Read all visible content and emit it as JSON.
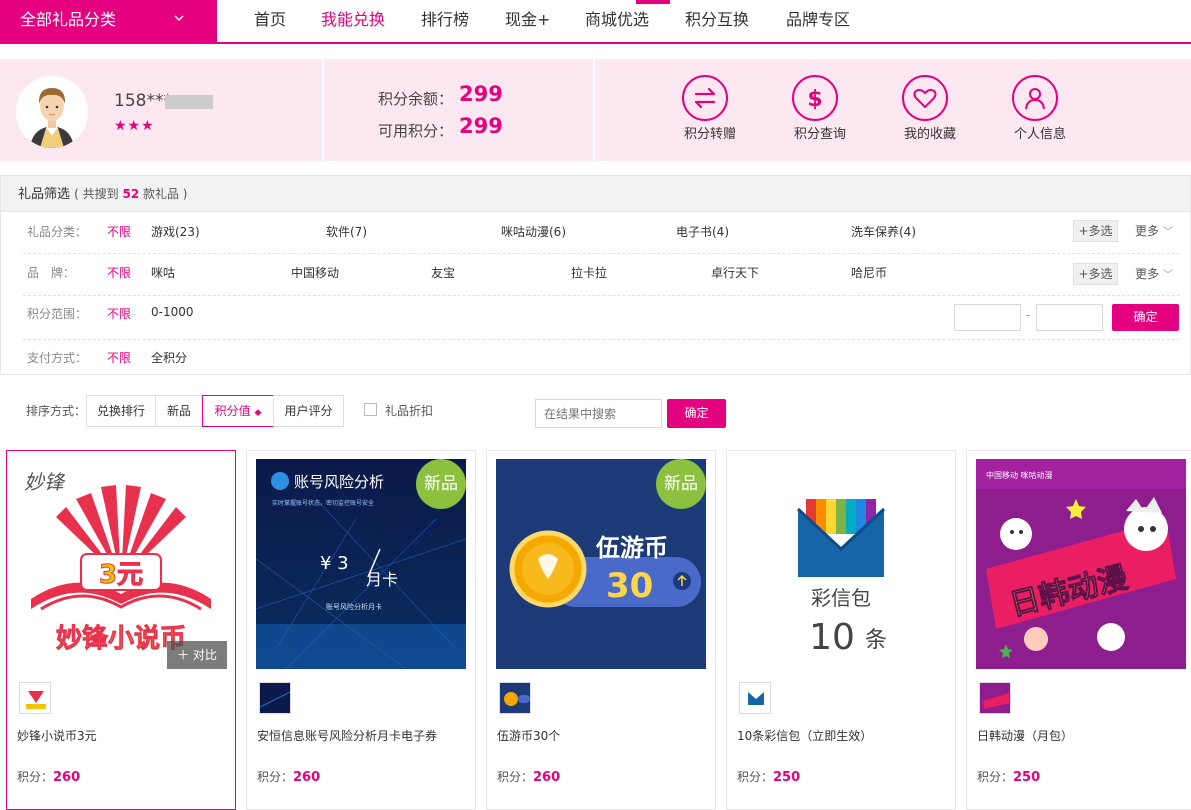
{
  "nav": {
    "category_button": "全部礼品分类",
    "items": [
      "首页",
      "我能兑换",
      "排行榜",
      "现金+",
      "商城优选",
      "积分互换",
      "品牌专区"
    ],
    "active_index": 1
  },
  "user": {
    "phone": "158***",
    "stars": "★★★",
    "balance_label": "积分余额：",
    "balance": "299",
    "available_label": "可用积分：",
    "available": "299",
    "actions": [
      "积分转赠",
      "积分查询",
      "我的收藏",
      "个人信息"
    ],
    "action_icons": [
      "transfer-icon",
      "dollar-icon",
      "heart-icon",
      "person-icon"
    ]
  },
  "filter": {
    "title": "礼品筛选",
    "count_prefix": "( 共搜到 ",
    "count": "52",
    "count_suffix": " 款礼品 )",
    "unlimited": "不限",
    "multi": "+多选",
    "more": "更多",
    "rows": [
      {
        "label": "礼品分类：",
        "options": [
          "游戏(23)",
          "软件(7)",
          "咪咕动漫(6)",
          "电子书(4)",
          "洗车保养(4)"
        ]
      },
      {
        "label": "品　牌：",
        "options": [
          "咪咕",
          "中国移动",
          "友宝",
          "拉卡拉",
          "卓行天下",
          "哈尼币"
        ]
      },
      {
        "label": "积分范围：",
        "options": [
          "0-1000"
        ]
      },
      {
        "label": "支付方式：",
        "options": [
          "全积分"
        ]
      }
    ],
    "range_sep": "-",
    "confirm": "确定"
  },
  "sort": {
    "label": "排序方式：",
    "buttons": [
      "兑换排行",
      "新品",
      "积分值",
      "用户评分"
    ],
    "active_index": 2,
    "discount_label": "礼品折扣",
    "search_placeholder": "在结果中搜索",
    "confirm": "确定"
  },
  "products": [
    {
      "name": "妙锋小说币3元",
      "price_label": "积分：",
      "price": "260",
      "new": false,
      "compare": "对比",
      "img_text": "妙锋",
      "img_amount": "3元",
      "img_caption": "妙锋小说币"
    },
    {
      "name": "安恒信息账号风险分析月卡电子券",
      "price_label": "积分：",
      "price": "260",
      "new": true,
      "badge": "新品",
      "img_title": "账号风险分析",
      "img_sub": "实时掌握账号状态，密切监控账号安全",
      "img_price": "¥ 3",
      "img_card": "月卡",
      "img_caption": "账号风险分析月卡"
    },
    {
      "name": "伍游币30个",
      "price_label": "积分：",
      "price": "260",
      "new": true,
      "badge": "新品",
      "img_title": "伍游币",
      "img_amount": "30"
    },
    {
      "name": "10条彩信包（立即生效）",
      "price_label": "积分：",
      "price": "250",
      "new": false,
      "img_title": "彩信包",
      "img_amount": "10",
      "img_unit": "条"
    },
    {
      "name": "日韩动漫（月包）",
      "price_label": "积分：",
      "price": "250",
      "new": false,
      "img_title": "日韩动漫",
      "img_brand": "中国移动 咪咕动漫"
    }
  ],
  "colors": {
    "accent": "#e4007f",
    "new_badge": "#8cc13f",
    "user_bg": "#fde8f1"
  }
}
